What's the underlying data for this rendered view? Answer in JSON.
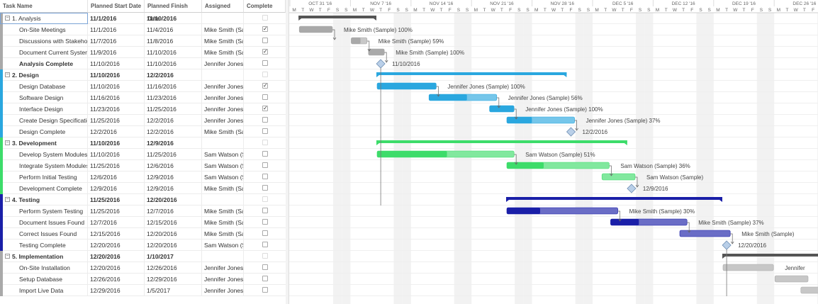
{
  "columns": {
    "task_name": "Task Name",
    "start": "Planned Start Date",
    "finish": "Planned Finish Date",
    "assigned": "Assigned",
    "complete": "Complete"
  },
  "colors": {
    "analysis": "#a9a9a9",
    "design": "#2aa7df",
    "development": "#3ddc6a",
    "testing": "#1a1fa8",
    "implementation": "#a9a9a9"
  },
  "rows": [
    {
      "name": "1. Analysis",
      "level": 0,
      "summary": true,
      "group": "analysis",
      "start": "11/1/2016",
      "finish": "11/10/2016",
      "assigned": "",
      "complete": null
    },
    {
      "name": "On-Site Meetings",
      "level": 1,
      "group": "analysis",
      "start": "11/1/2016",
      "finish": "11/4/2016",
      "assigned": "Mike Smith (Sample)",
      "complete": true
    },
    {
      "name": "Discussions with Stakeholders",
      "level": 1,
      "group": "analysis",
      "start": "11/7/2016",
      "finish": "11/8/2016",
      "assigned": "Mike Smith (Sample)",
      "complete": false
    },
    {
      "name": "Document Current Systems",
      "level": 1,
      "group": "analysis",
      "start": "11/9/2016",
      "finish": "11/10/2016",
      "assigned": "Mike Smith (Sample)",
      "complete": true
    },
    {
      "name": "Analysis Complete",
      "level": 1,
      "bold": true,
      "group": "analysis",
      "start": "11/10/2016",
      "finish": "11/10/2016",
      "assigned": "Jennifer Jones",
      "complete": false
    },
    {
      "name": "2. Design",
      "level": 0,
      "summary": true,
      "group": "design",
      "start": "11/10/2016",
      "finish": "12/2/2016",
      "assigned": "",
      "complete": null
    },
    {
      "name": "Design Database",
      "level": 1,
      "group": "design",
      "start": "11/10/2016",
      "finish": "11/16/2016",
      "assigned": "Jennifer Jones",
      "complete": true
    },
    {
      "name": "Software Design",
      "level": 1,
      "group": "design",
      "start": "11/16/2016",
      "finish": "11/23/2016",
      "assigned": "Jennifer Jones",
      "complete": false
    },
    {
      "name": "Interface Design",
      "level": 1,
      "group": "design",
      "start": "11/23/2016",
      "finish": "11/25/2016",
      "assigned": "Jennifer Jones",
      "complete": true
    },
    {
      "name": "Create Design Specification",
      "level": 1,
      "group": "design",
      "start": "11/25/2016",
      "finish": "12/2/2016",
      "assigned": "Jennifer Jones",
      "complete": false
    },
    {
      "name": "Design Complete",
      "level": 1,
      "group": "design",
      "start": "12/2/2016",
      "finish": "12/2/2016",
      "assigned": "Mike Smith (Sample)",
      "complete": false
    },
    {
      "name": "3. Development",
      "level": 0,
      "summary": true,
      "group": "development",
      "start": "11/10/2016",
      "finish": "12/9/2016",
      "assigned": "",
      "complete": null
    },
    {
      "name": "Develop System Modules",
      "level": 1,
      "group": "development",
      "start": "11/10/2016",
      "finish": "11/25/2016",
      "assigned": "Sam Watson (Sample)",
      "complete": false
    },
    {
      "name": "Integrate System Modules",
      "level": 1,
      "group": "development",
      "start": "11/25/2016",
      "finish": "12/6/2016",
      "assigned": "Sam Watson (Sample)",
      "complete": false
    },
    {
      "name": "Perform Initial Testing",
      "level": 1,
      "group": "development",
      "start": "12/6/2016",
      "finish": "12/9/2016",
      "assigned": "Sam Watson (Sample)",
      "complete": false
    },
    {
      "name": "Development Complete",
      "level": 1,
      "group": "development",
      "start": "12/9/2016",
      "finish": "12/9/2016",
      "assigned": "Mike Smith (Sample)",
      "complete": false
    },
    {
      "name": "4. Testing",
      "level": 0,
      "summary": true,
      "group": "testing",
      "start": "11/25/2016",
      "finish": "12/20/2016",
      "assigned": "",
      "complete": null
    },
    {
      "name": "Perform System Testing",
      "level": 1,
      "group": "testing",
      "start": "11/25/2016",
      "finish": "12/7/2016",
      "assigned": "Mike Smith (Sample)",
      "complete": false
    },
    {
      "name": "Document Issues Found",
      "level": 1,
      "group": "testing",
      "start": "12/7/2016",
      "finish": "12/15/2016",
      "assigned": "Mike Smith (Sample)",
      "complete": false
    },
    {
      "name": "Correct Issues Found",
      "level": 1,
      "group": "testing",
      "start": "12/15/2016",
      "finish": "12/20/2016",
      "assigned": "Mike Smith (Sample)",
      "complete": false
    },
    {
      "name": "Testing Complete",
      "level": 1,
      "group": "testing",
      "start": "12/20/2016",
      "finish": "12/20/2016",
      "assigned": "Sam Watson (Sample)",
      "complete": false
    },
    {
      "name": "5. Implementation",
      "level": 0,
      "summary": true,
      "group": "implementation",
      "start": "12/20/2016",
      "finish": "1/10/2017",
      "assigned": "",
      "complete": null
    },
    {
      "name": "On-Site Installation",
      "level": 1,
      "group": "implementation",
      "start": "12/20/2016",
      "finish": "12/26/2016",
      "assigned": "Jennifer Jones",
      "complete": false
    },
    {
      "name": "Setup Database",
      "level": 1,
      "group": "implementation",
      "start": "12/26/2016",
      "finish": "12/29/2016",
      "assigned": "Jennifer Jones",
      "complete": false
    },
    {
      "name": "Import Live Data",
      "level": 1,
      "group": "implementation",
      "start": "12/29/2016",
      "finish": "1/5/2017",
      "assigned": "Jennifer Jones",
      "complete": false
    }
  ],
  "timeline": {
    "first_day": "2016-10-31",
    "day_letters": [
      "M",
      "T",
      "W",
      "T",
      "F",
      "S",
      "S"
    ],
    "week_labels": [
      "OCT 31 '16",
      "NOV 7 '16",
      "NOV 14 '16",
      "NOV 21 '16",
      "NOV 28 '16",
      "DEC 5 '16",
      "DEC 12 '16",
      "DEC 19 '16",
      "DEC 26 '16"
    ]
  },
  "bars": [
    {
      "row": 0,
      "type": "summary",
      "start": "2016-11-01",
      "end": "2016-11-10",
      "group": "analysis",
      "label": ""
    },
    {
      "row": 1,
      "type": "task",
      "start": "2016-11-01",
      "end": "2016-11-05",
      "group": "analysis",
      "pct": 100,
      "label": "Mike Smith (Sample)  100%"
    },
    {
      "row": 2,
      "type": "task",
      "start": "2016-11-07",
      "end": "2016-11-09",
      "group": "analysis",
      "pct": 59,
      "label": "Mike Smith (Sample)  59%"
    },
    {
      "row": 3,
      "type": "task",
      "start": "2016-11-09",
      "end": "2016-11-11",
      "group": "analysis",
      "pct": 100,
      "label": "Mike Smith (Sample)  100%"
    },
    {
      "row": 4,
      "type": "milestone",
      "start": "2016-11-10",
      "group": "analysis",
      "label": "11/10/2016"
    },
    {
      "row": 5,
      "type": "summary",
      "start": "2016-11-10",
      "end": "2016-12-02",
      "group": "design",
      "label": ""
    },
    {
      "row": 6,
      "type": "task",
      "start": "2016-11-10",
      "end": "2016-11-17",
      "group": "design",
      "pct": 100,
      "label": "Jennifer Jones (Sample)  100%"
    },
    {
      "row": 7,
      "type": "task",
      "start": "2016-11-16",
      "end": "2016-11-24",
      "group": "design",
      "pct": 56,
      "label": "Jennifer Jones (Sample)  56%"
    },
    {
      "row": 8,
      "type": "task",
      "start": "2016-11-23",
      "end": "2016-11-26",
      "group": "design",
      "pct": 100,
      "label": "Jennifer Jones (Sample)  100%"
    },
    {
      "row": 9,
      "type": "task",
      "start": "2016-11-25",
      "end": "2016-12-03",
      "group": "design",
      "pct": 37,
      "label": "Jennifer Jones (Sample)  37%"
    },
    {
      "row": 10,
      "type": "milestone",
      "start": "2016-12-02",
      "group": "design",
      "label": "12/2/2016"
    },
    {
      "row": 11,
      "type": "summary",
      "start": "2016-11-10",
      "end": "2016-12-09",
      "group": "development",
      "label": ""
    },
    {
      "row": 12,
      "type": "task",
      "start": "2016-11-10",
      "end": "2016-11-26",
      "group": "development",
      "pct": 51,
      "label": "Sam Watson (Sample)  51%"
    },
    {
      "row": 13,
      "type": "task",
      "start": "2016-11-25",
      "end": "2016-12-07",
      "group": "development",
      "pct": 36,
      "label": "Sam Watson (Sample)  36%"
    },
    {
      "row": 14,
      "type": "task",
      "start": "2016-12-06",
      "end": "2016-12-10",
      "group": "development",
      "pct": 0,
      "label": "Sam Watson (Sample)"
    },
    {
      "row": 15,
      "type": "milestone",
      "start": "2016-12-09",
      "group": "development",
      "label": "12/9/2016"
    },
    {
      "row": 16,
      "type": "summary",
      "start": "2016-11-25",
      "end": "2016-12-20",
      "group": "testing",
      "label": ""
    },
    {
      "row": 17,
      "type": "task",
      "start": "2016-11-25",
      "end": "2016-12-08",
      "group": "testing",
      "pct": 30,
      "label": "Mike Smith (Sample)  30%"
    },
    {
      "row": 18,
      "type": "task",
      "start": "2016-12-07",
      "end": "2016-12-16",
      "group": "testing",
      "pct": 37,
      "label": "Mike Smith (Sample)  37%"
    },
    {
      "row": 19,
      "type": "task",
      "start": "2016-12-15",
      "end": "2016-12-21",
      "group": "testing",
      "pct": 0,
      "label": "Mike Smith (Sample)"
    },
    {
      "row": 20,
      "type": "milestone",
      "start": "2016-12-20",
      "group": "testing",
      "label": "12/20/2016"
    },
    {
      "row": 21,
      "type": "summary",
      "start": "2016-12-20",
      "end": "2017-01-10",
      "group": "implementation",
      "label": ""
    },
    {
      "row": 22,
      "type": "task",
      "start": "2016-12-20",
      "end": "2016-12-26",
      "group": "implementation",
      "pct": 0,
      "label": "Jennifer"
    },
    {
      "row": 23,
      "type": "task",
      "start": "2016-12-26",
      "end": "2016-12-30",
      "group": "implementation",
      "pct": 0,
      "label": ""
    },
    {
      "row": 24,
      "type": "task",
      "start": "2016-12-29",
      "end": "2017-01-05",
      "group": "implementation",
      "pct": 0,
      "label": ""
    }
  ]
}
